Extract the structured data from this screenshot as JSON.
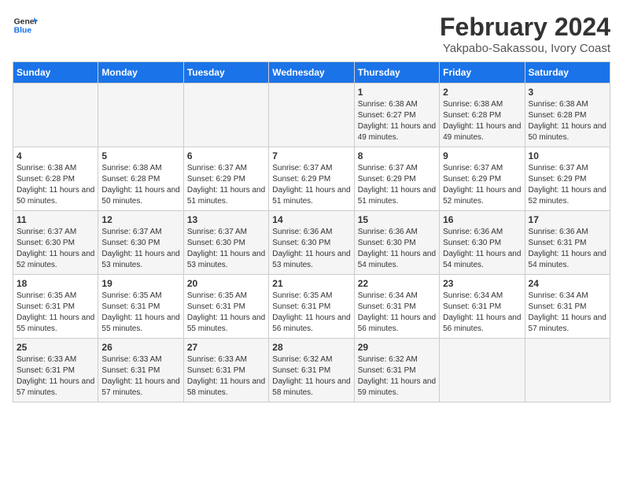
{
  "header": {
    "logo_line1": "General",
    "logo_line2": "Blue",
    "title": "February 2024",
    "subtitle": "Yakpabo-Sakassou, Ivory Coast"
  },
  "weekdays": [
    "Sunday",
    "Monday",
    "Tuesday",
    "Wednesday",
    "Thursday",
    "Friday",
    "Saturday"
  ],
  "weeks": [
    [
      {
        "day": "",
        "info": ""
      },
      {
        "day": "",
        "info": ""
      },
      {
        "day": "",
        "info": ""
      },
      {
        "day": "",
        "info": ""
      },
      {
        "day": "1",
        "info": "Sunrise: 6:38 AM\nSunset: 6:27 PM\nDaylight: 11 hours and 49 minutes."
      },
      {
        "day": "2",
        "info": "Sunrise: 6:38 AM\nSunset: 6:28 PM\nDaylight: 11 hours and 49 minutes."
      },
      {
        "day": "3",
        "info": "Sunrise: 6:38 AM\nSunset: 6:28 PM\nDaylight: 11 hours and 50 minutes."
      }
    ],
    [
      {
        "day": "4",
        "info": "Sunrise: 6:38 AM\nSunset: 6:28 PM\nDaylight: 11 hours and 50 minutes."
      },
      {
        "day": "5",
        "info": "Sunrise: 6:38 AM\nSunset: 6:28 PM\nDaylight: 11 hours and 50 minutes."
      },
      {
        "day": "6",
        "info": "Sunrise: 6:37 AM\nSunset: 6:29 PM\nDaylight: 11 hours and 51 minutes."
      },
      {
        "day": "7",
        "info": "Sunrise: 6:37 AM\nSunset: 6:29 PM\nDaylight: 11 hours and 51 minutes."
      },
      {
        "day": "8",
        "info": "Sunrise: 6:37 AM\nSunset: 6:29 PM\nDaylight: 11 hours and 51 minutes."
      },
      {
        "day": "9",
        "info": "Sunrise: 6:37 AM\nSunset: 6:29 PM\nDaylight: 11 hours and 52 minutes."
      },
      {
        "day": "10",
        "info": "Sunrise: 6:37 AM\nSunset: 6:29 PM\nDaylight: 11 hours and 52 minutes."
      }
    ],
    [
      {
        "day": "11",
        "info": "Sunrise: 6:37 AM\nSunset: 6:30 PM\nDaylight: 11 hours and 52 minutes."
      },
      {
        "day": "12",
        "info": "Sunrise: 6:37 AM\nSunset: 6:30 PM\nDaylight: 11 hours and 53 minutes."
      },
      {
        "day": "13",
        "info": "Sunrise: 6:37 AM\nSunset: 6:30 PM\nDaylight: 11 hours and 53 minutes."
      },
      {
        "day": "14",
        "info": "Sunrise: 6:36 AM\nSunset: 6:30 PM\nDaylight: 11 hours and 53 minutes."
      },
      {
        "day": "15",
        "info": "Sunrise: 6:36 AM\nSunset: 6:30 PM\nDaylight: 11 hours and 54 minutes."
      },
      {
        "day": "16",
        "info": "Sunrise: 6:36 AM\nSunset: 6:30 PM\nDaylight: 11 hours and 54 minutes."
      },
      {
        "day": "17",
        "info": "Sunrise: 6:36 AM\nSunset: 6:31 PM\nDaylight: 11 hours and 54 minutes."
      }
    ],
    [
      {
        "day": "18",
        "info": "Sunrise: 6:35 AM\nSunset: 6:31 PM\nDaylight: 11 hours and 55 minutes."
      },
      {
        "day": "19",
        "info": "Sunrise: 6:35 AM\nSunset: 6:31 PM\nDaylight: 11 hours and 55 minutes."
      },
      {
        "day": "20",
        "info": "Sunrise: 6:35 AM\nSunset: 6:31 PM\nDaylight: 11 hours and 55 minutes."
      },
      {
        "day": "21",
        "info": "Sunrise: 6:35 AM\nSunset: 6:31 PM\nDaylight: 11 hours and 56 minutes."
      },
      {
        "day": "22",
        "info": "Sunrise: 6:34 AM\nSunset: 6:31 PM\nDaylight: 11 hours and 56 minutes."
      },
      {
        "day": "23",
        "info": "Sunrise: 6:34 AM\nSunset: 6:31 PM\nDaylight: 11 hours and 56 minutes."
      },
      {
        "day": "24",
        "info": "Sunrise: 6:34 AM\nSunset: 6:31 PM\nDaylight: 11 hours and 57 minutes."
      }
    ],
    [
      {
        "day": "25",
        "info": "Sunrise: 6:33 AM\nSunset: 6:31 PM\nDaylight: 11 hours and 57 minutes."
      },
      {
        "day": "26",
        "info": "Sunrise: 6:33 AM\nSunset: 6:31 PM\nDaylight: 11 hours and 57 minutes."
      },
      {
        "day": "27",
        "info": "Sunrise: 6:33 AM\nSunset: 6:31 PM\nDaylight: 11 hours and 58 minutes."
      },
      {
        "day": "28",
        "info": "Sunrise: 6:32 AM\nSunset: 6:31 PM\nDaylight: 11 hours and 58 minutes."
      },
      {
        "day": "29",
        "info": "Sunrise: 6:32 AM\nSunset: 6:31 PM\nDaylight: 11 hours and 59 minutes."
      },
      {
        "day": "",
        "info": ""
      },
      {
        "day": "",
        "info": ""
      }
    ]
  ]
}
